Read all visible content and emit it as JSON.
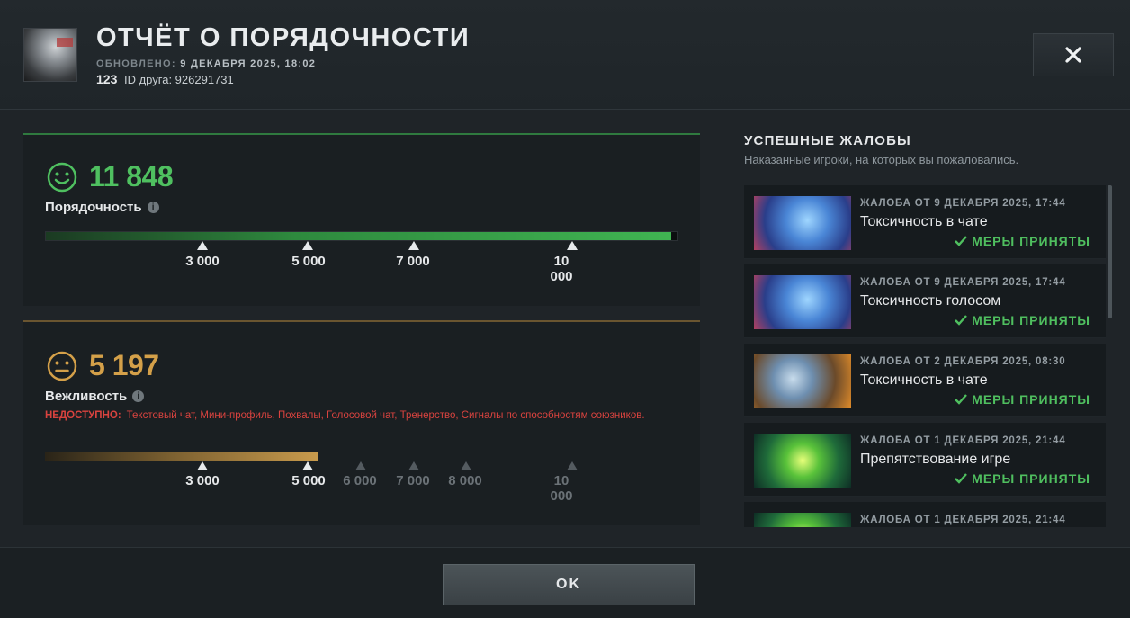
{
  "header": {
    "title": "ОТЧЁТ О ПОРЯДОЧНОСТИ",
    "updated_label": "ОБНОВЛЕНО:",
    "updated_value": "9 ДЕКАБРЯ 2025, 18:02",
    "friend_number": "123",
    "friend_id": "ID друга: 926291731"
  },
  "conduct": {
    "score": "11 848",
    "label": "Порядочность",
    "fill_fraction": 1.0,
    "ticks": [
      "3 000",
      "5 000",
      "7 000",
      "10\n000"
    ]
  },
  "politeness": {
    "score": "5 197",
    "label": "Вежливость",
    "unavailable_key": "НЕДОСТУПНО:",
    "unavailable_text": "Текстовый чат, Мини-профиль, Похвалы, Голосовой чат, Тренерство, Сигналы по способностям союзников.",
    "ticks_active": [
      "3 000",
      "5 000"
    ],
    "ticks_inactive": [
      "6 000",
      "7 000",
      "8 000",
      "10\n000"
    ]
  },
  "reports_panel": {
    "title": "УСПЕШНЫЕ ЖАЛОБЫ",
    "subtitle": "Наказанные игроки, на которых вы пожаловались.",
    "items": [
      {
        "meta": "ЖАЛОБА ОТ 9 ДЕКАБРЯ 2025, 17:44",
        "reason": "Токсичность в чате",
        "status": "МЕРЫ ПРИНЯТЫ"
      },
      {
        "meta": "ЖАЛОБА ОТ 9 ДЕКАБРЯ 2025, 17:44",
        "reason": "Токсичность голосом",
        "status": "МЕРЫ ПРИНЯТЫ"
      },
      {
        "meta": "ЖАЛОБА ОТ 2 ДЕКАБРЯ 2025, 08:30",
        "reason": "Токсичность в чате",
        "status": "МЕРЫ ПРИНЯТЫ"
      },
      {
        "meta": "ЖАЛОБА ОТ 1 ДЕКАБРЯ 2025, 21:44",
        "reason": "Препятствование игре",
        "status": "МЕРЫ ПРИНЯТЫ"
      },
      {
        "meta": "ЖАЛОБА ОТ 1 ДЕКАБРЯ 2025, 21:44",
        "reason": "",
        "status": ""
      }
    ]
  },
  "footer": {
    "ok_label": "OK"
  },
  "colors": {
    "green": "#4fc060",
    "gold": "#d4a049",
    "red": "#d9433f"
  }
}
